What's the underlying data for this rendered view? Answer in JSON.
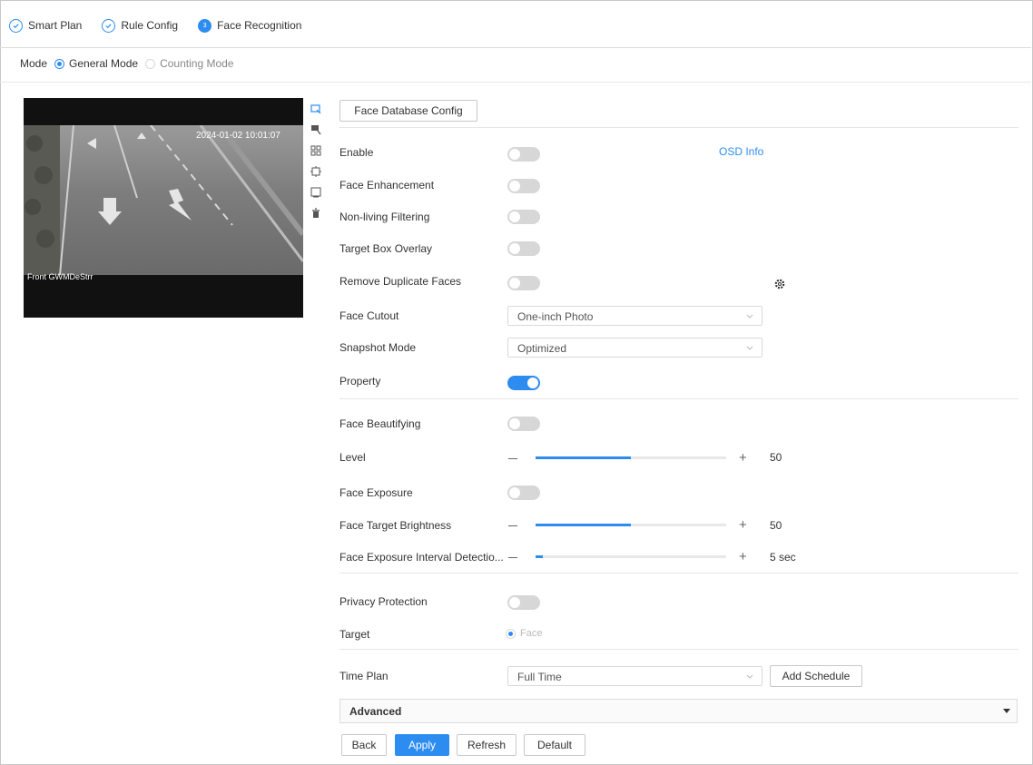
{
  "steps": [
    {
      "label": "Smart Plan",
      "state": "done"
    },
    {
      "label": "Rule Config",
      "state": "done"
    },
    {
      "label": "Face Recognition",
      "state": "active",
      "icon_text": "3"
    }
  ],
  "mode": {
    "label": "Mode",
    "options": [
      "General Mode",
      "Counting Mode"
    ],
    "selected": "General Mode"
  },
  "video": {
    "osd_time": "2024-01-02 10:01:07",
    "osd_channel": "Front GWMDeStrr"
  },
  "video_tools": [
    "select-area-icon",
    "draw-rule-icon",
    "grid-icon",
    "target-filter-icon",
    "min-size-icon",
    "delete-icon"
  ],
  "form": {
    "face_db_button": "Face Database Config",
    "osd_info": "OSD Info",
    "enable": {
      "label": "Enable",
      "on": false
    },
    "face_enhancement": {
      "label": "Face Enhancement",
      "on": false
    },
    "non_living": {
      "label": "Non-living Filtering",
      "on": false
    },
    "target_box": {
      "label": "Target Box Overlay",
      "on": false
    },
    "remove_duplicate": {
      "label": "Remove Duplicate Faces",
      "on": false
    },
    "face_cutout": {
      "label": "Face Cutout",
      "value": "One-inch Photo"
    },
    "snapshot_mode": {
      "label": "Snapshot Mode",
      "value": "Optimized"
    },
    "property": {
      "label": "Property",
      "on": true
    },
    "face_beautifying": {
      "label": "Face Beautifying",
      "on": false
    },
    "level": {
      "label": "Level",
      "value": "50",
      "fraction": 0.5
    },
    "face_exposure": {
      "label": "Face Exposure",
      "on": false
    },
    "face_target_brightness": {
      "label": "Face Target Brightness",
      "value": "50",
      "fraction": 0.5
    },
    "face_exposure_interval": {
      "label": "Face Exposure Interval Detectio...",
      "value": "5 sec",
      "fraction": 0.04
    },
    "privacy_protection": {
      "label": "Privacy Protection",
      "on": false
    },
    "target": {
      "label": "Target",
      "option": "Face"
    },
    "time_plan": {
      "label": "Time Plan",
      "value": "Full Time",
      "add_schedule": "Add Schedule"
    },
    "advanced": "Advanced"
  },
  "buttons": {
    "back": "Back",
    "apply": "Apply",
    "refresh": "Refresh",
    "default": "Default"
  },
  "colors": {
    "accent": "#2d8cf0"
  }
}
